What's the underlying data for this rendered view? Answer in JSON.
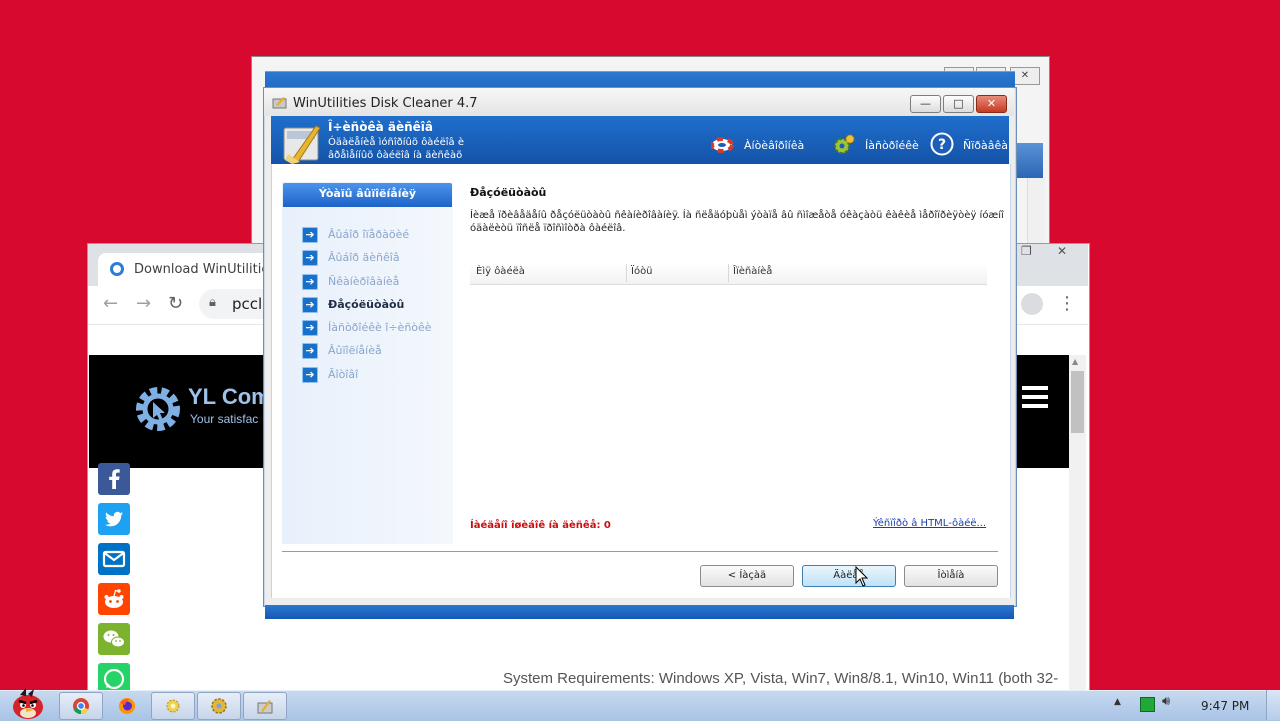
{
  "dialog": {
    "title": "WinUtilities Disk Cleaner 4.7",
    "banner_title": "Î÷èñòêà äèñêîâ",
    "banner_desc_line1": "Óäàëåíèå ìóñîðíûõ ôàéëîâ è",
    "banner_desc_line2": "âðåìåííûõ ôàéëîâ íà äèñêàõ",
    "toolbar": [
      {
        "label": "Àíòèâîðîíêà",
        "icon": "lifebuoy-icon"
      },
      {
        "label": "Íàñòðîéêè",
        "icon": "gear-icon"
      },
      {
        "label": "Ñïðàâêà",
        "icon": "help-icon"
      }
    ],
    "steps_header": "Ýòàïû âûïîëíåíèÿ",
    "steps": [
      {
        "label": "Âûáîð îïåðàöèé",
        "active": false
      },
      {
        "label": "Âûáîð äèñêîâ",
        "active": false
      },
      {
        "label": "Ñêàíèðîâàíèå",
        "active": false
      },
      {
        "label": "Ðåçóëüòàòû",
        "active": true
      },
      {
        "label": "Íàñòðîéêè î÷èñòêè",
        "active": false
      },
      {
        "label": "Âûïîëíåíèå",
        "active": false
      },
      {
        "label": "Ãîòîâî",
        "active": false
      }
    ],
    "section_title": "Ðåçóëüòàòû",
    "section_desc_line1": "Íèæå ïðèâåäåíû ðåçóëüòàòû ñêàíèðîâàíèÿ. Íà ñëåäóþùåì ýòàïå âû ñìîæåòå óêàçàòü êàêèå ìåðîïðèÿòèÿ íóæíî",
    "section_desc_line2": "óäàëèòü ïîñëå ïðîñìîòðà ôàéëîâ.",
    "columns": [
      "Èìÿ ôàéëà",
      "Ïóòü",
      "Îïèñàíèå"
    ],
    "status": "Íàéäåíî îøèáîê íà äèñêå: 0",
    "save_link": "Ýêñïîðò â HTML-ôàéë...",
    "buttons": {
      "back": "< Íàçàä",
      "next": "Äàëåå",
      "cancel": "Îòìåíà"
    },
    "window_controls": {
      "minimize": "—",
      "maximize": "□",
      "close": "✕"
    }
  },
  "browser": {
    "tab_title": "Download WinUtilities",
    "url": "pccle",
    "site_title": "YL Com",
    "site_tagline": "Your satisfac",
    "system_requirements": "System Requirements: Windows XP, Vista, Win7, Win8/8.1, Win10, Win11 (both 32-",
    "share_buttons": [
      {
        "name": "facebook",
        "color": "#3b5998"
      },
      {
        "name": "twitter",
        "color": "#1da1f2"
      },
      {
        "name": "email",
        "color": "#0072c6"
      },
      {
        "name": "reddit",
        "color": "#ff4500"
      },
      {
        "name": "wechat",
        "color": "#7bb32e"
      },
      {
        "name": "whatsapp",
        "color": "#25d366"
      }
    ]
  },
  "taskbar": {
    "clock": "9:47 PM",
    "apps": [
      "chrome",
      "firefox",
      "folder",
      "winutilities-settings",
      "disk-cleaner"
    ]
  },
  "colors": {
    "desktop": "#d8092e",
    "banner": "#1f6fcc",
    "status_error": "#c81010"
  }
}
